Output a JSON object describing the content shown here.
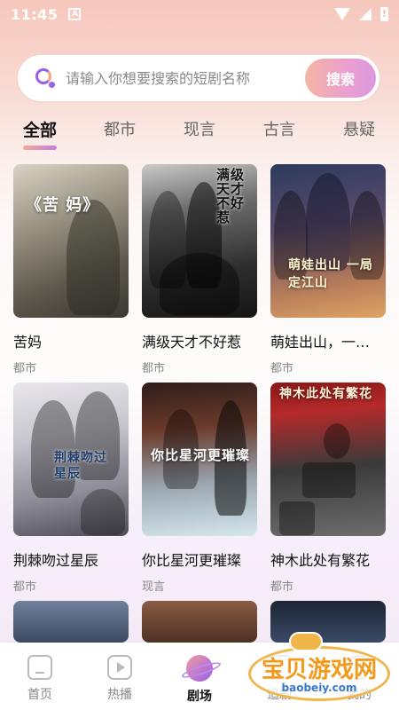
{
  "status_bar": {
    "time": "11:45",
    "notification_icon": "A"
  },
  "search": {
    "placeholder": "请输入你想要搜索的短剧名称",
    "button_label": "搜索"
  },
  "tabs": [
    {
      "label": "全部",
      "active": true
    },
    {
      "label": "都市",
      "active": false
    },
    {
      "label": "现言",
      "active": false
    },
    {
      "label": "古言",
      "active": false
    },
    {
      "label": "悬疑",
      "active": false
    }
  ],
  "dramas": [
    {
      "title": "苦妈",
      "tag": "都市",
      "poster_text": "《苦 妈》"
    },
    {
      "title": "满级天才不好惹",
      "tag": "都市",
      "poster_text": "满级天才不好惹"
    },
    {
      "title": "萌娃出山，一…",
      "tag": "都市",
      "poster_text": "萌娃出山 一局定江山"
    },
    {
      "title": "荆棘吻过星辰",
      "tag": "都市",
      "poster_text": "荆棘吻过星辰"
    },
    {
      "title": "你比星河更璀璨",
      "tag": "现言",
      "poster_text": "你比星河更璀璨"
    },
    {
      "title": "神木此处有繁花",
      "tag": "都市",
      "poster_text": "神木此处有繁花"
    }
  ],
  "bottom_nav": [
    {
      "label": "首页",
      "icon": "home-icon",
      "active": false
    },
    {
      "label": "热播",
      "icon": "play-icon",
      "active": false
    },
    {
      "label": "剧场",
      "icon": "planet-icon",
      "active": true
    },
    {
      "label": "追剧",
      "icon": "follow-icon",
      "active": false
    },
    {
      "label": "我的",
      "icon": "me-icon",
      "active": false
    }
  ],
  "watermark": {
    "text": "宝贝游戏网",
    "url": "baobeiy.com"
  },
  "colors": {
    "accent_start": "#f4a89a",
    "accent_end": "#c77fe0",
    "watermark_orange": "#f39a1c"
  }
}
